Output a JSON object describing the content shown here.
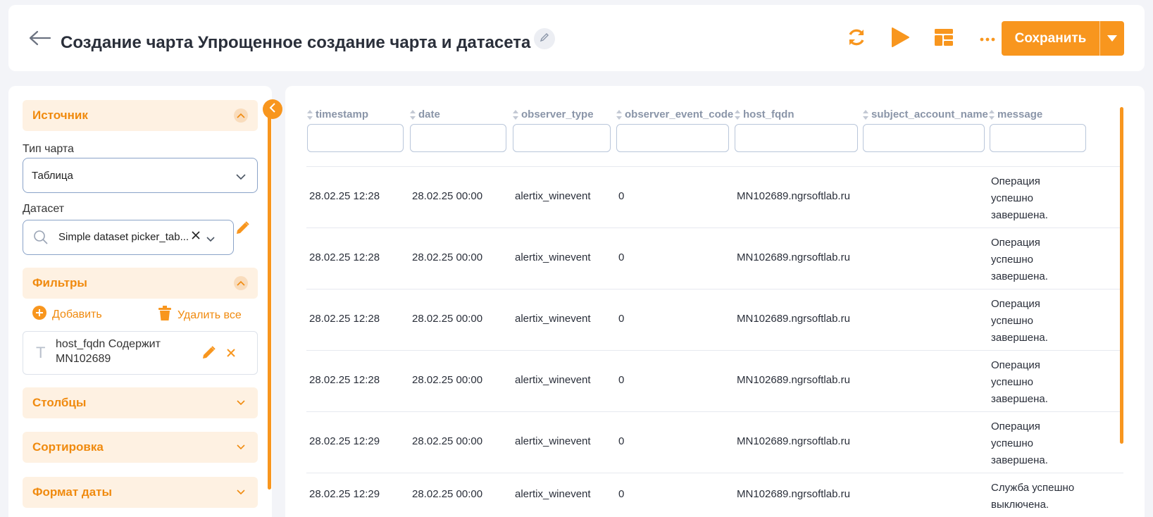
{
  "header": {
    "title": "Создание чарта Упрощенное создание чарта и датасета",
    "save_label": "Сохранить",
    "icons": [
      "back-arrow-icon",
      "pencil-icon",
      "refresh-icon",
      "play-icon",
      "layout-icon",
      "more-icon",
      "caret-down-icon"
    ]
  },
  "sidebar": {
    "source": {
      "title": "Источник",
      "chart_type_label": "Тип чарта",
      "chart_type_value": "Таблица",
      "dataset_label": "Датасет",
      "dataset_value": "Simple dataset picker_tab..."
    },
    "filters": {
      "title": "Фильтры",
      "add_label": "Добавить",
      "delete_all_label": "Удалить все",
      "items": [
        {
          "type_glyph": "T",
          "text_line1": "host_fqdn Содержит",
          "text_line2": "MN102689"
        }
      ]
    },
    "columns_title": "Столбцы",
    "sorting_title": "Сортировка",
    "date_format_title": "Формат даты"
  },
  "table": {
    "columns": [
      "timestamp",
      "date",
      "observer_type",
      "observer_event_code",
      "host_fqdn",
      "subject_account_name",
      "message"
    ],
    "rows": [
      {
        "timestamp": "28.02.25 12:28",
        "date": "28.02.25 00:00",
        "observer_type": "alertix_winevent",
        "observer_event_code": "0",
        "host_fqdn": "MN102689.ngrsoftlab.ru",
        "subject_account_name": "",
        "message": "Операция успешно завершена."
      },
      {
        "timestamp": "28.02.25 12:28",
        "date": "28.02.25 00:00",
        "observer_type": "alertix_winevent",
        "observer_event_code": "0",
        "host_fqdn": "MN102689.ngrsoftlab.ru",
        "subject_account_name": "",
        "message": "Операция успешно завершена."
      },
      {
        "timestamp": "28.02.25 12:28",
        "date": "28.02.25 00:00",
        "observer_type": "alertix_winevent",
        "observer_event_code": "0",
        "host_fqdn": "MN102689.ngrsoftlab.ru",
        "subject_account_name": "",
        "message": "Операция успешно завершена."
      },
      {
        "timestamp": "28.02.25 12:28",
        "date": "28.02.25 00:00",
        "observer_type": "alertix_winevent",
        "observer_event_code": "0",
        "host_fqdn": "MN102689.ngrsoftlab.ru",
        "subject_account_name": "",
        "message": "Операция успешно завершена."
      },
      {
        "timestamp": "28.02.25 12:29",
        "date": "28.02.25 00:00",
        "observer_type": "alertix_winevent",
        "observer_event_code": "0",
        "host_fqdn": "MN102689.ngrsoftlab.ru",
        "subject_account_name": "",
        "message": "Операция успешно завершена."
      },
      {
        "timestamp": "28.02.25 12:29",
        "date": "28.02.25 00:00",
        "observer_type": "alertix_winevent",
        "observer_event_code": "0",
        "host_fqdn": "MN102689.ngrsoftlab.ru",
        "subject_account_name": "",
        "message": "Служба успешно выключена."
      }
    ]
  },
  "colors": {
    "accent": "#f8961e",
    "accent_text": "#f08a0e",
    "section_bg": "#fef1e2",
    "header_text": "#8a95a8"
  }
}
